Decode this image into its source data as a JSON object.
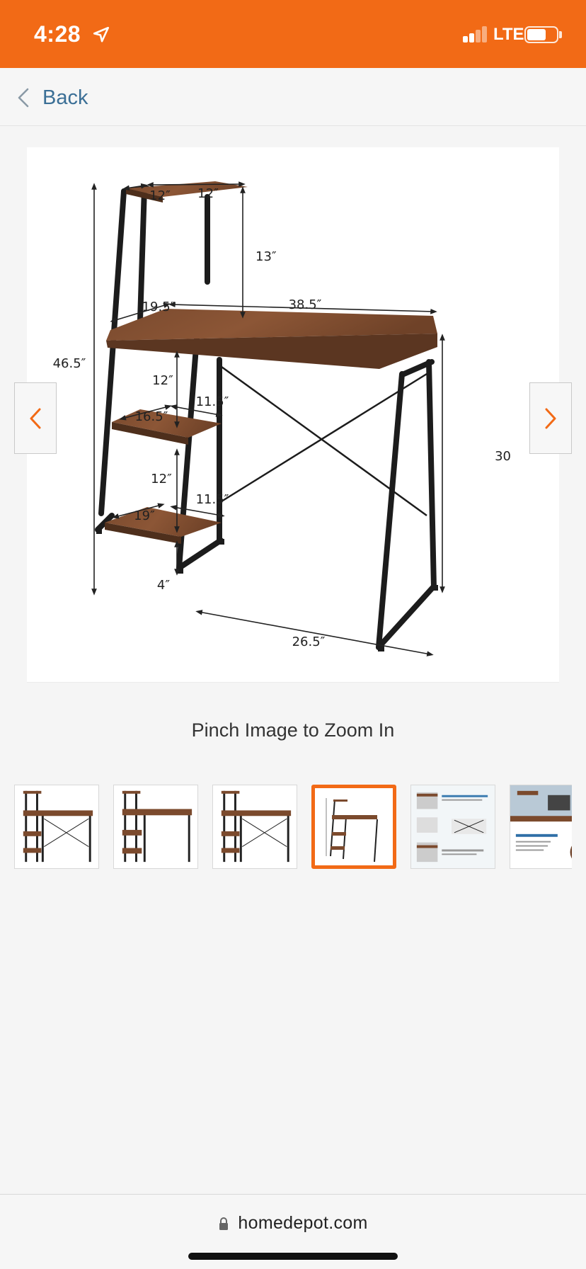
{
  "status_bar": {
    "time": "4:28",
    "network": "LTE",
    "background_color": "#f26a16",
    "location_icon": "location-arrow-icon",
    "battery_level": 0.65
  },
  "nav": {
    "back_label": "Back",
    "back_icon": "chevron-left-icon"
  },
  "image": {
    "dimensions": {
      "top_shelf_depth": "12″",
      "top_shelf_width": "12″",
      "top_shelf_gap": "13″",
      "desk_depth": "19.5″",
      "desk_width": "38.5″",
      "total_height": "46.5″",
      "shelf_spacing_upper": "12″",
      "mid_shelf_depth": "16.5″",
      "mid_shelf_width": "11.5″",
      "shelf_spacing_lower": "12″",
      "lower_shelf_depth": "19″",
      "lower_shelf_width": "11.5″",
      "floor_clearance": "4″",
      "base_depth": "26.5″",
      "desk_height": "30"
    },
    "prev_icon": "chevron-left-icon",
    "next_icon": "chevron-right-icon"
  },
  "zoom_hint": "Pinch Image to Zoom In",
  "thumbnails": {
    "selected_index": 3,
    "accent_color": "#f26a16",
    "items": [
      "desk-front-view",
      "desk-angle-view",
      "desk-side-view",
      "desk-dimensions",
      "desk-feature-details",
      "desk-lifestyle"
    ]
  },
  "browser": {
    "url": "homedepot.com",
    "lock_icon": "lock-icon"
  }
}
